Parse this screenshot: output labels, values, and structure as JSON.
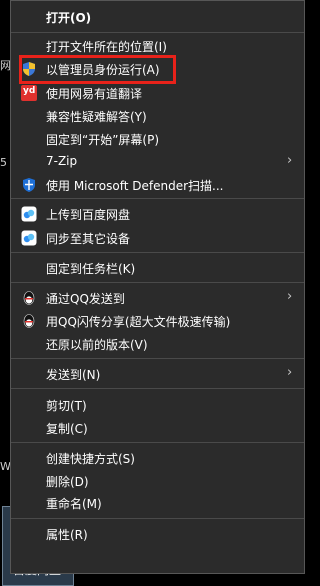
{
  "desktop": {
    "edge_letters": [
      "网",
      "5",
      "W"
    ],
    "icon_label": "百度网盘"
  },
  "menu": {
    "items": [
      {
        "label": "打开(O)"
      },
      {
        "label": "打开文件所在的位置(I)"
      },
      {
        "label": "以管理员身份运行(A)"
      },
      {
        "label": "使用网易有道翻译"
      },
      {
        "label": "兼容性疑难解答(Y)"
      },
      {
        "label": "固定到“开始”屏幕(P)"
      },
      {
        "label": "7-Zip",
        "submenu_arrow": "›"
      },
      {
        "label": "使用 Microsoft Defender扫描..."
      },
      {
        "label": "上传到百度网盘"
      },
      {
        "label": "同步至其它设备"
      },
      {
        "label": "固定到任务栏(K)"
      },
      {
        "label": "通过QQ发送到",
        "submenu_arrow": "›"
      },
      {
        "label": "用QQ闪传分享(超大文件极速传输)"
      },
      {
        "label": "还原以前的版本(V)"
      },
      {
        "label": "发送到(N)",
        "submenu_arrow": "›"
      },
      {
        "label": "剪切(T)"
      },
      {
        "label": "复制(C)"
      },
      {
        "label": "创建快捷方式(S)"
      },
      {
        "label": "删除(D)"
      },
      {
        "label": "重命名(M)"
      },
      {
        "label": "属性(R)"
      }
    ],
    "icons": {
      "youdao_glyph": "yd",
      "qq_glyph": "●"
    }
  },
  "colors": {
    "menu_background": "#2b2b2b",
    "menu_text": "#ffffff",
    "separator": "#4a4a4a",
    "highlight_border": "#e8221a",
    "youdao_red": "#e0312e",
    "defender_blue": "#1e6fd6"
  }
}
